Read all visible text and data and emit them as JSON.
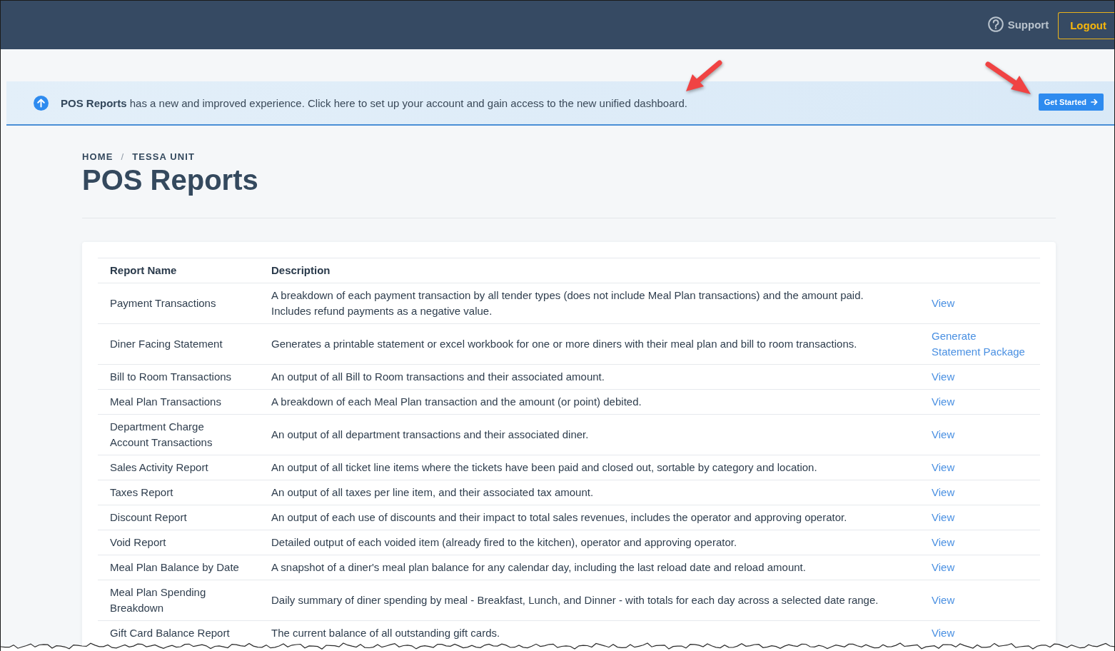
{
  "header": {
    "support_link": "Support",
    "logout_button": "Logout"
  },
  "banner": {
    "message": "**POS Reports** has a new and improved experience. Click here to set up your account and gain access to the new unified dashboard.",
    "button": "Get Started"
  },
  "breadcrumb": {
    "items": [
      "HOME",
      "TESSA UNIT"
    ],
    "separator": "/"
  },
  "page_title": "POS Reports",
  "table": {
    "columns": [
      "Report Name",
      "Description"
    ],
    "rows": [
      {
        "name": "Payment Transactions",
        "description": "A breakdown of each payment transaction by all tender types (does not include Meal Plan transactions) and the amount paid. Includes refund payments as a negative value.",
        "action": "View"
      },
      {
        "name": "Diner Facing Statement",
        "description": "Generates a printable statement or excel workbook for one or more diners with their meal plan and bill to room transactions.",
        "action": "Generate Statement Package"
      },
      {
        "name": "Bill to Room Transactions",
        "description": "An output of all Bill to Room transactions and their associated amount.",
        "action": "View"
      },
      {
        "name": "Meal Plan Transactions",
        "description": "A breakdown of each Meal Plan transaction and the amount (or point) debited.",
        "action": "View"
      },
      {
        "name": "Department Charge Account Transactions",
        "description": "An output of all department transactions and their associated diner.",
        "action": "View"
      },
      {
        "name": "Sales Activity Report",
        "description": "An output of all ticket line items where the tickets have been paid and closed out, sortable by category and location.",
        "action": "View"
      },
      {
        "name": "Taxes Report",
        "description": "An output of all taxes per line item, and their associated tax amount.",
        "action": "View"
      },
      {
        "name": "Discount Report",
        "description": "An output of each use of discounts and their impact to total sales revenues, includes the operator and approving operator.",
        "action": "View"
      },
      {
        "name": "Void Report",
        "description": "Detailed output of each voided item (already fired to the kitchen), operator and approving operator.",
        "action": "View"
      },
      {
        "name": "Meal Plan Balance by Date",
        "description": "A snapshot of a diner's meal plan balance for any calendar day, including the last reload date and reload amount.",
        "action": "View"
      },
      {
        "name": "Meal Plan Spending Breakdown",
        "description": "Daily summary of diner spending by meal - Breakfast, Lunch, and Dinner - with totals for each day across a selected date range.",
        "action": "View"
      },
      {
        "name": "Gift Card Balance Report",
        "description": "The current balance of all outstanding gift cards.",
        "action": "View"
      }
    ]
  }
}
